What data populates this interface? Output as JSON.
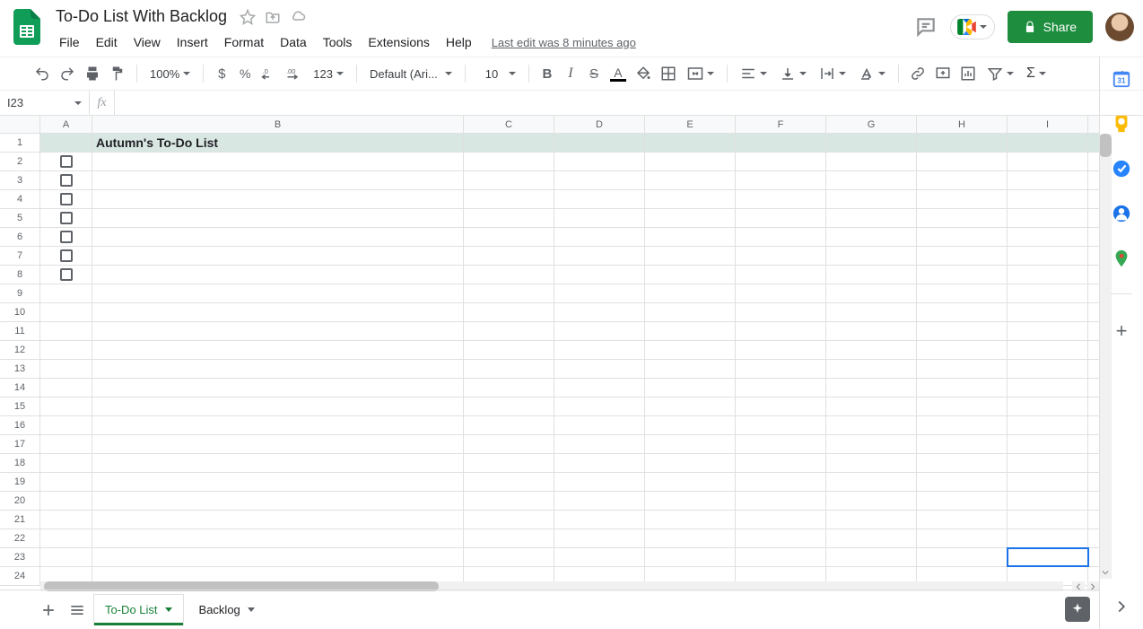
{
  "doc": {
    "title": "To-Do List With Backlog",
    "last_edit": "Last edit was 8 minutes ago"
  },
  "menu": {
    "file": "File",
    "edit": "Edit",
    "view": "View",
    "insert": "Insert",
    "format": "Format",
    "data": "Data",
    "tools": "Tools",
    "extensions": "Extensions",
    "help": "Help"
  },
  "share": {
    "label": "Share"
  },
  "toolbar": {
    "zoom": "100%",
    "font": "Default (Ari...",
    "font_size": "10",
    "more_formats": "123"
  },
  "namebox": {
    "ref": "I23"
  },
  "columns": [
    "A",
    "B",
    "C",
    "D",
    "E",
    "F",
    "G",
    "H",
    "I"
  ],
  "column_classes": [
    "c-a",
    "c-b",
    "c-c",
    "c-d",
    "c-e",
    "c-f",
    "c-g",
    "c-h",
    "c-i"
  ],
  "rows": 24,
  "active_cell": {
    "row": 23,
    "col": 8
  },
  "checkbox_rows": [
    2,
    3,
    4,
    5,
    6,
    7,
    8
  ],
  "content": {
    "b1": "Autumn's To-Do List"
  },
  "tabs": {
    "list": [
      {
        "label": "To-Do List",
        "active": true
      },
      {
        "label": "Backlog",
        "active": false
      }
    ]
  }
}
